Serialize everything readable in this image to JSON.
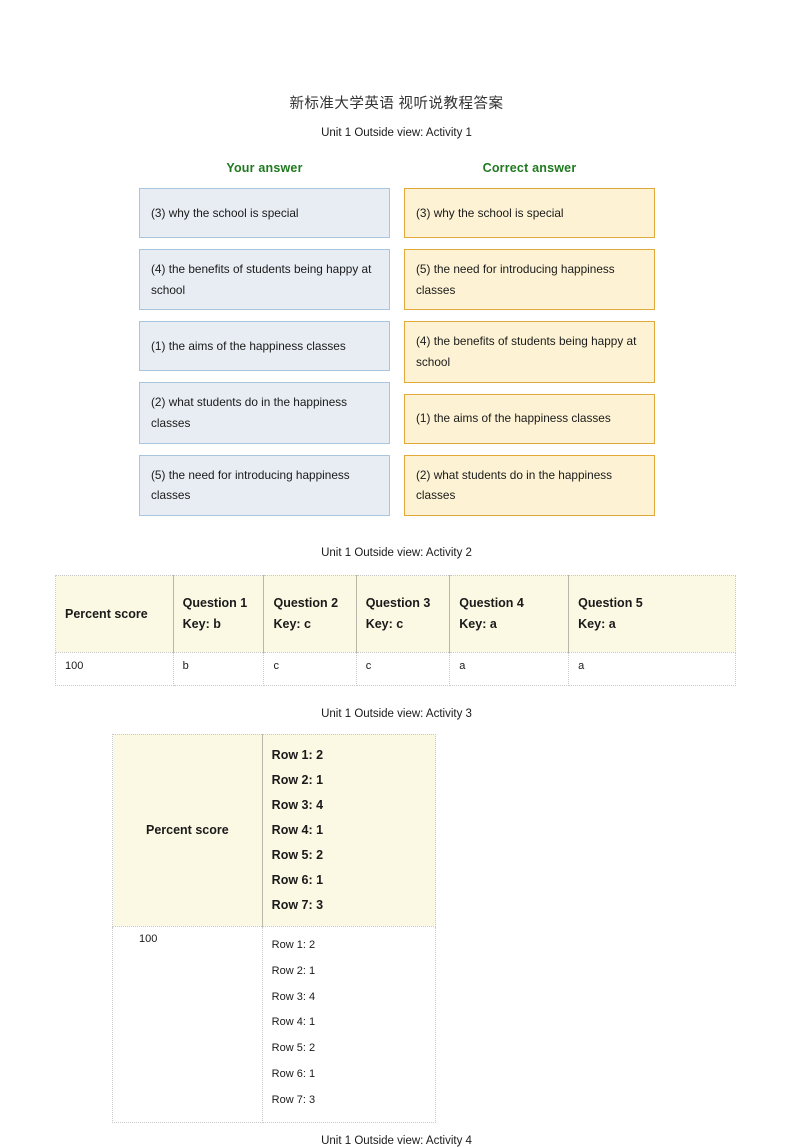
{
  "document": {
    "title": "新标准大学英语 视听说教程答案"
  },
  "captions": {
    "activity1": "Unit 1 Outside view: Activity 1",
    "activity2": "Unit 1 Outside view: Activity 2",
    "activity3": "Unit 1 Outside view: Activity 3",
    "activity4": "Unit 1 Outside view: Activity 4"
  },
  "activity1": {
    "columns": {
      "your_answer": "Your answer",
      "correct_answer": "Correct answer"
    },
    "your_answers": [
      "(3) why the school is special",
      "(4) the benefits of students being happy at school",
      "(1) the aims of the happiness classes",
      "(2) what students do in the happiness classes",
      "(5) the need for introducing happiness classes"
    ],
    "correct_answers": [
      "(3) why the school is special",
      "(5) the need for introducing happiness classes",
      "(4) the benefits of students being happy at school",
      "(1) the aims of the happiness classes",
      "(2) what students do in the happiness classes"
    ],
    "colors": {
      "your_fill": "#e7edf3",
      "your_border": "#a9c6de",
      "correct_fill": "#fdf3d4",
      "correct_border": "#e3a83a",
      "header_text": "#1f7a1f"
    }
  },
  "activity2": {
    "headers": {
      "score": "Percent score",
      "q1_line1": "Question 1",
      "q1_line2": "Key: b",
      "q2_line1": "Question 2",
      "q2_line2": "Key: c",
      "q3_line1": "Question 3",
      "q3_line2": "Key: c",
      "q4_line1": "Question 4",
      "q4_line2": "Key: a",
      "q5_line1": "Question 5",
      "q5_line2": "Key: a"
    },
    "row": {
      "score": "100",
      "q1": "b",
      "q2": "c",
      "q3": "c",
      "q4": "a",
      "q5": "a"
    }
  },
  "activity3": {
    "headers": {
      "score": "Percent score",
      "rows": [
        "Row 1: 2",
        "Row 2: 1",
        "Row 3: 4",
        "Row 4: 1",
        "Row 5: 2",
        "Row 6: 1",
        "Row 7: 3"
      ]
    },
    "row": {
      "score": "100",
      "rows": [
        "Row 1: 2",
        "Row 2: 1",
        "Row 3: 4",
        "Row 4: 1",
        "Row 5: 2",
        "Row 6: 1",
        "Row 7: 3"
      ]
    }
  }
}
